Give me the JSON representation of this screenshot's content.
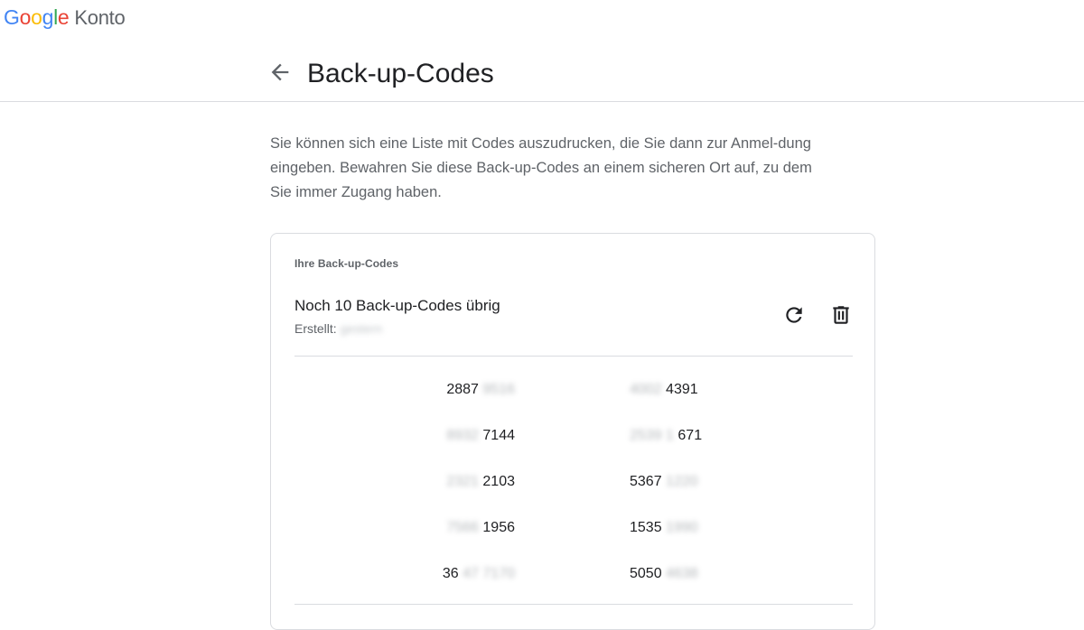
{
  "brand": {
    "letters": [
      "G",
      "o",
      "o",
      "g",
      "l",
      "e"
    ],
    "product": "Konto",
    "colors": {
      "blue": "#4285F4",
      "red": "#EA4335",
      "yellow": "#FBBC05",
      "green": "#34A853"
    }
  },
  "header": {
    "back_icon": "arrow-back-icon",
    "title": "Back-up-Codes"
  },
  "description": "Sie können sich eine Liste mit Codes auszudrucken, die Sie dann zur Anmel-dung eingeben. Bewahren Sie diese Back-up-Codes an einem sicheren Ort auf, zu dem Sie immer Zugang haben.",
  "card": {
    "label": "Ihre Back-up-Codes",
    "status": "Noch 10 Back-up-Codes übrig",
    "created_label": "Erstellt:",
    "created_value": "gestern",
    "refresh_icon": "refresh-icon",
    "delete_icon": "trash-icon",
    "codes": [
      {
        "visible": "2887",
        "hidden": "9516",
        "order": "visible-first"
      },
      {
        "visible": "4391",
        "hidden": "4002",
        "order": "hidden-first"
      },
      {
        "visible": "7144",
        "hidden": "8932",
        "order": "hidden-first"
      },
      {
        "visible": "671",
        "hidden": "2539 1",
        "order": "hidden-first"
      },
      {
        "visible": "2103",
        "hidden": "2321",
        "order": "hidden-first"
      },
      {
        "visible": "5367",
        "hidden": "1220",
        "order": "visible-first"
      },
      {
        "visible": "1956",
        "hidden": "7566",
        "order": "hidden-first"
      },
      {
        "visible": "1535",
        "hidden": "1990",
        "order": "visible-first"
      },
      {
        "visible": "36",
        "hidden": "47 7170",
        "order": "visible-first"
      },
      {
        "visible": "5050",
        "hidden": "4638",
        "order": "visible-first"
      }
    ]
  }
}
